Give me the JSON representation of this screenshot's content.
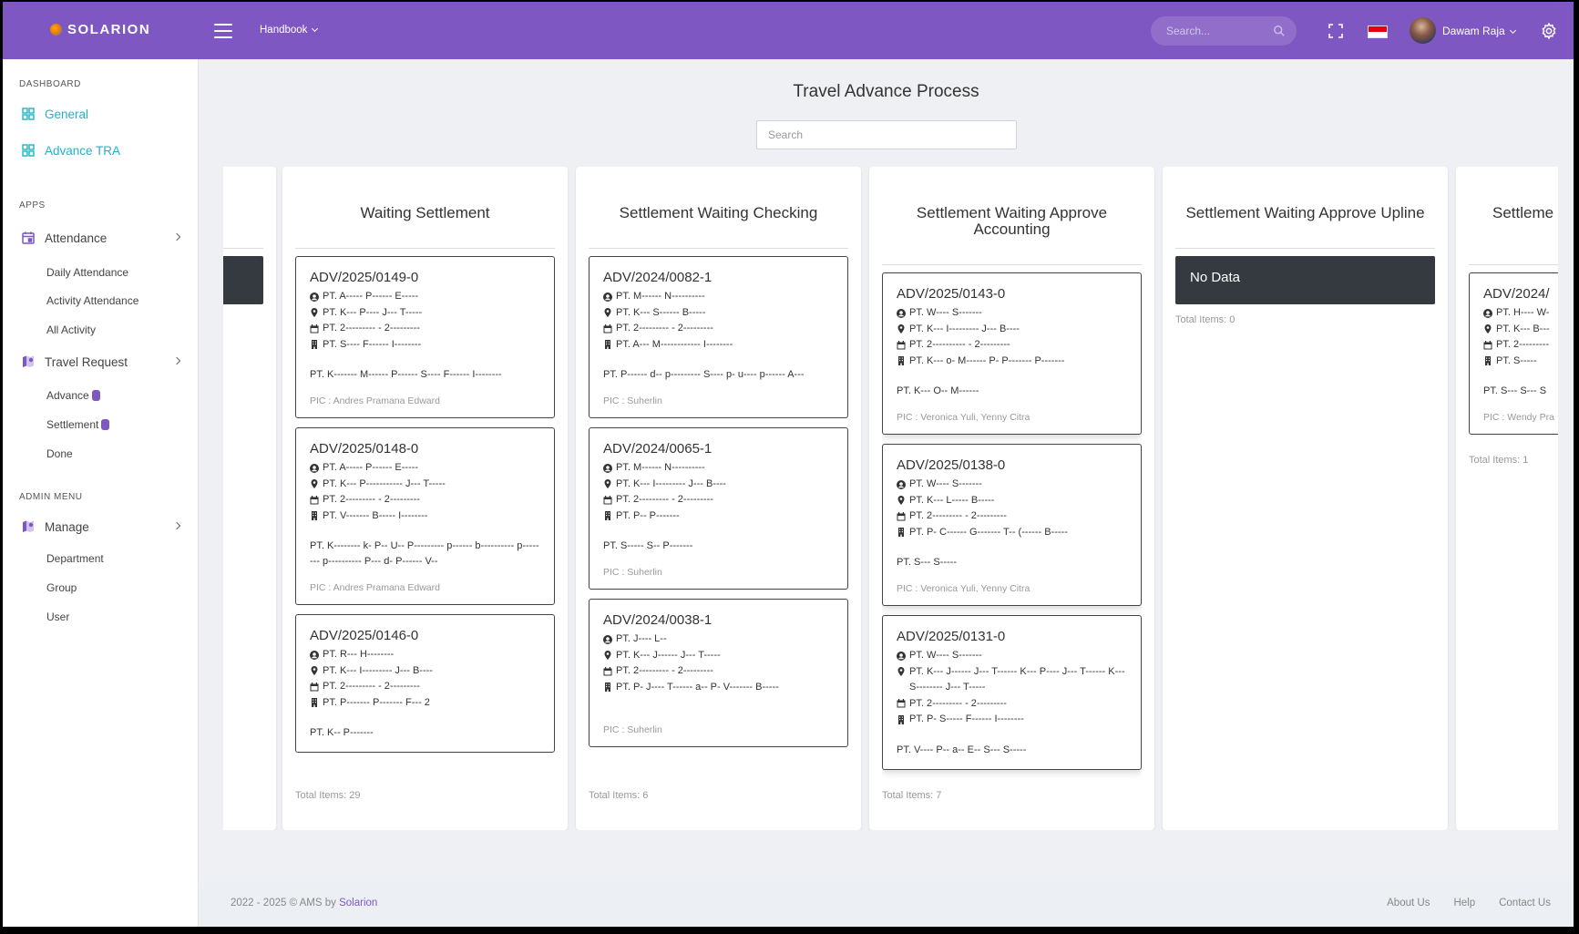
{
  "brand": {
    "name": "SOLARION"
  },
  "topbar": {
    "menu_label": "Handbook",
    "search_placeholder": "Search...",
    "user_name": "Dawam Raja",
    "flag_colors": [
      "#e70011",
      "#ffffff"
    ],
    "accent": "#7e57c2"
  },
  "sidebar": {
    "sections": [
      "DASHBOARD",
      "APPS",
      "ADMIN MENU"
    ],
    "dashboard": [
      {
        "label": "General",
        "icon": "dashboard-icon"
      },
      {
        "label": "Advance TRA",
        "icon": "dashboard-icon"
      }
    ],
    "attendance": {
      "label": "Attendance",
      "icon": "calendar-icon",
      "children": [
        "Daily Attendance",
        "Activity Attendance",
        "All Activity"
      ]
    },
    "travel": {
      "label": "Travel Request",
      "icon": "map-icon",
      "children": [
        "Advance",
        "Settlement",
        "Done"
      ]
    },
    "manage": {
      "label": "Manage",
      "icon": "map-icon",
      "children": [
        "Department",
        "Group",
        "User"
      ]
    }
  },
  "main": {
    "title": "Travel Advance Process",
    "search_placeholder": "Search",
    "columns": [
      {
        "title": "Waiting Settlement",
        "total": "Total Items: 29",
        "cards": [
          {
            "id": "ADV/2025/0149-0",
            "user": "PT. A----- P------ E-----",
            "location": "PT. K--- P---- J--- T-----",
            "date": "PT. 2--------- - 2---------",
            "company": "PT. S---- F------ I--------",
            "note": "PT. K------- M------ P------ S---- F------ I--------",
            "pic": "PIC : Andres Pramana Edward"
          },
          {
            "id": "ADV/2025/0148-0",
            "user": "PT. A----- P------ E-----",
            "location": "PT. K--- P----------- J--- T-----",
            "date": "PT. 2--------- - 2---------",
            "company": "PT. V------- B----- I--------",
            "note": "PT. K-------- k- P-- U-- P--------- p------ b----------  p-------- p---------- P--- d- P------ V--",
            "pic": "PIC : Andres Pramana Edward"
          },
          {
            "id": "ADV/2025/0146-0",
            "user": "PT. R--- H--------",
            "location": "PT. K--- I--------- J--- B----",
            "date": "PT. 2--------- - 2---------",
            "company": "PT. P------- P------- F--- 2",
            "note": "PT. K-- P-------",
            "pic": ""
          }
        ]
      },
      {
        "title": "Settlement Waiting Checking",
        "total": "Total Items: 6",
        "cards": [
          {
            "id": "ADV/2024/0082-1",
            "user": "PT. M------ N----------",
            "location": "PT. K--- S------ B-----",
            "date": "PT. 2--------- - 2---------",
            "company": "PT. A--- M------------ I--------",
            "note": "PT. P------ d-- p--------- S---- p- u---- p------ A---",
            "pic": "PIC : Suherlin"
          },
          {
            "id": "ADV/2024/0065-1",
            "user": "PT. M------ N----------",
            "location": "PT. K--- I--------- J--- B----",
            "date": "PT. 2--------- - 2---------",
            "company": "PT. P-- P-------",
            "note": "PT. S----- S-- P-------",
            "pic": "PIC : Suherlin"
          },
          {
            "id": "ADV/2024/0038-1",
            "user": "PT. J---- L--",
            "location": "PT. K--- J------ J--- T-----",
            "date": "PT. 2--------- - 2---------",
            "company": "PT. P- J---- T------ a-- P- V------- B-----",
            "note": "",
            "pic": "PIC : Suherlin"
          }
        ]
      },
      {
        "title": "Settlement Waiting Approve Accounting",
        "total": "Total Items: 7",
        "cards": [
          {
            "id": "ADV/2025/0143-0",
            "user": "PT. W---- S-------",
            "location": "PT. K--- I--------- J--- B----",
            "date": "PT. 2---------- - 2---------",
            "company": "PT. K--- o- M------ P- P------- P-------",
            "note": "PT. K--- O-- M------",
            "pic": "PIC : Veronica Yuli, Yenny Citra"
          },
          {
            "id": "ADV/2025/0138-0",
            "user": "PT. W---- S-------",
            "location": "PT. K--- L----- B-----",
            "date": "PT. 2--------- - 2---------",
            "company": "PT. P- C------ G------- T-- (------ B-----",
            "note": "PT. S--- S-----",
            "pic": "PIC : Veronica Yuli, Yenny Citra"
          },
          {
            "id": "ADV/2025/0131-0",
            "user": "PT. W---- S-------",
            "location": "PT. K--- J------ J--- T------ K--- P---- J--- T------  K--- S-------- J--- T-----",
            "date": "PT. 2--------- - 2---------",
            "company": "PT. P- S----- F------ I--------",
            "note": "PT. V---- P-- a-- E-- S--- S-----",
            "pic": ""
          }
        ]
      },
      {
        "title": "Settlement Waiting Approve Upline",
        "total": "Total Items: 0",
        "no_data": "No Data"
      },
      {
        "title": "Settleme",
        "total": "Total Items: 1",
        "cards": [
          {
            "id": "ADV/2024/",
            "user": "PT. H---- W-",
            "location": "PT. K--- B---",
            "date": "PT. 2---------",
            "company": "PT. S-----",
            "note": "PT. S--- S--- S",
            "pic": "PIC : Wendy Pra"
          }
        ]
      }
    ]
  },
  "footer": {
    "copyright": "2022 - 2025 © AMS by",
    "brand_link": "Solarion",
    "links": [
      "About Us",
      "Help",
      "Contact Us"
    ]
  }
}
